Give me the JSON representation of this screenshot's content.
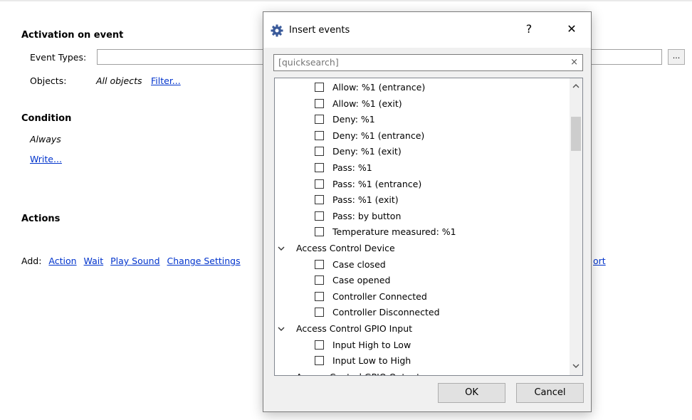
{
  "page": {
    "activation_heading": "Activation on event",
    "event_types_label": "Event Types:",
    "event_types_button": "...",
    "objects_label": "Objects:",
    "objects_value": "All objects",
    "filter_link": "Filter...",
    "condition_heading": "Condition",
    "condition_value": "Always",
    "write_link": "Write...",
    "actions_heading": "Actions",
    "add_label": "Add:",
    "add_links": [
      "Action",
      "Wait",
      "Play Sound",
      "Change Settings"
    ],
    "add_tail_partial": "ort"
  },
  "dialog": {
    "title": "Insert events",
    "help_label": "?",
    "close_label": "✕",
    "search_placeholder": "[quicksearch]",
    "search_clear": "×",
    "items": [
      {
        "type": "item",
        "label": "Allow: %1 (entrance)"
      },
      {
        "type": "item",
        "label": "Allow: %1 (exit)"
      },
      {
        "type": "item",
        "label": "Deny: %1"
      },
      {
        "type": "item",
        "label": "Deny: %1 (entrance)"
      },
      {
        "type": "item",
        "label": "Deny: %1 (exit)"
      },
      {
        "type": "item",
        "label": "Pass: %1"
      },
      {
        "type": "item",
        "label": "Pass: %1 (entrance)"
      },
      {
        "type": "item",
        "label": "Pass: %1 (exit)"
      },
      {
        "type": "item",
        "label": "Pass: by button"
      },
      {
        "type": "item",
        "label": "Temperature measured: %1"
      },
      {
        "type": "group",
        "label": "Access Control Device"
      },
      {
        "type": "item",
        "label": "Case closed"
      },
      {
        "type": "item",
        "label": "Case opened"
      },
      {
        "type": "item",
        "label": "Controller Connected"
      },
      {
        "type": "item",
        "label": "Controller Disconnected"
      },
      {
        "type": "group",
        "label": "Access Control GPIO Input"
      },
      {
        "type": "item",
        "label": "Input High to Low"
      },
      {
        "type": "item",
        "label": "Input Low to High"
      },
      {
        "type": "group",
        "label": "Access Control GPIO Output"
      }
    ],
    "ok_label": "OK",
    "cancel_label": "Cancel",
    "icons": {
      "title": "gear-icon",
      "expand": "chevron-down-icon",
      "scroll_up": "chevron-up-icon",
      "scroll_down": "chevron-down-icon"
    }
  }
}
